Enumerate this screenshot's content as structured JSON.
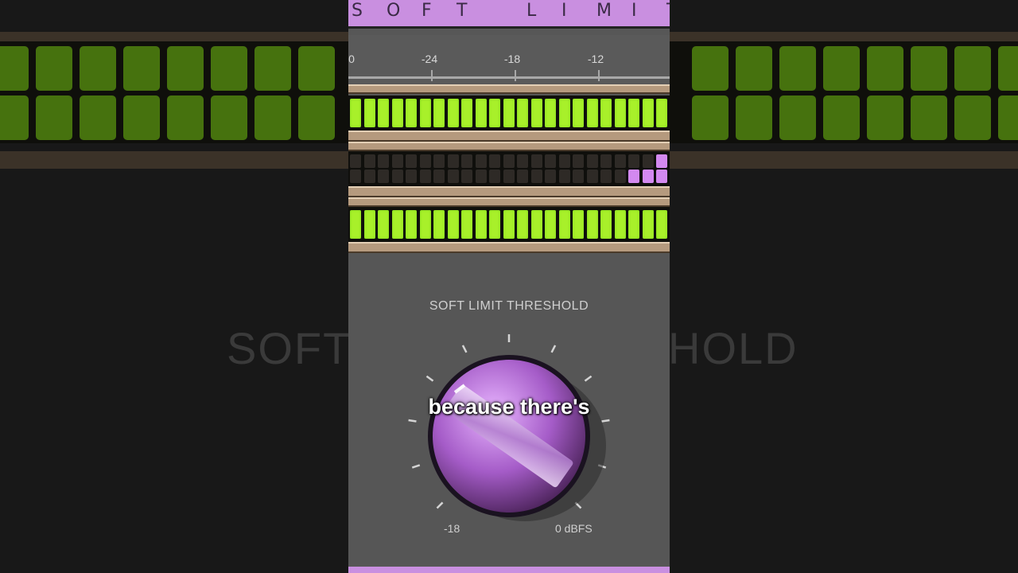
{
  "plugin": {
    "title": "SOFT LIMIT",
    "scale_labels": [
      "0",
      "-24",
      "-18",
      "-12"
    ],
    "meters": {
      "input_level_fraction": 1.0,
      "gain_reduction_segments": 4,
      "output_level_fraction": 1.0
    },
    "knob": {
      "label": "SOFT LIMIT THRESHOLD",
      "min_label": "-18",
      "max_label": "0 dBFS",
      "value_fraction": 0.55
    }
  },
  "background": {
    "blurred_text_left": "SOFT",
    "blurred_text_right": "HOLD"
  },
  "caption": {
    "text": "because there's"
  },
  "colors": {
    "accent_purple": "#c98fe0",
    "meter_green": "#a8f02a",
    "gr_purple": "#d389f0",
    "panel_gray": "#575757"
  }
}
